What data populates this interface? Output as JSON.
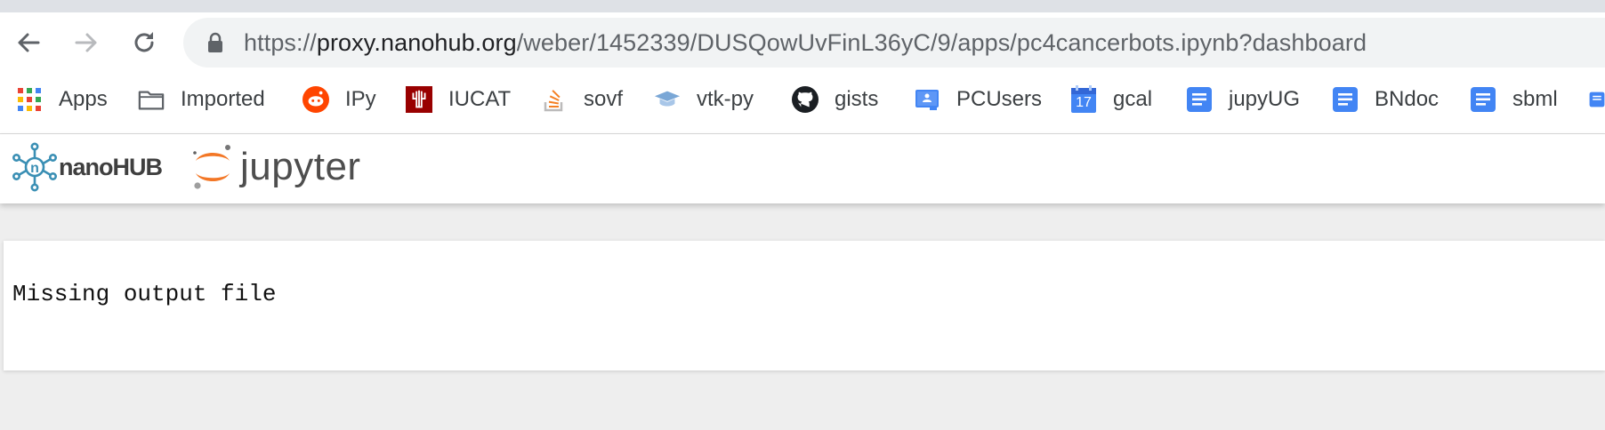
{
  "browser": {
    "url_scheme": "https://",
    "url_host": "proxy.nanohub.org",
    "url_path": "/weber/1452339/DUSQowUvFinL36yC/9/apps/pc4cancerbots.ipynb?dashboard"
  },
  "bookmarks": [
    {
      "label": "Apps",
      "icon": "apps-grid-icon"
    },
    {
      "label": "Imported",
      "icon": "folder-icon"
    },
    {
      "label": "IPy",
      "icon": "reddit-icon"
    },
    {
      "label": "IUCAT",
      "icon": "iu-trident-icon"
    },
    {
      "label": "sovf",
      "icon": "stackoverflow-icon"
    },
    {
      "label": "vtk-py",
      "icon": "graduation-cap-icon"
    },
    {
      "label": "gists",
      "icon": "github-icon"
    },
    {
      "label": "PCUsers",
      "icon": "google-classroom-icon"
    },
    {
      "label": "gcal",
      "icon": "calendar-icon",
      "badge": "17"
    },
    {
      "label": "jupyUG",
      "icon": "google-doc-icon"
    },
    {
      "label": "BNdoc",
      "icon": "google-doc-icon"
    },
    {
      "label": "sbml",
      "icon": "google-doc-icon"
    }
  ],
  "header": {
    "nanohub_logo_text": "nanoHUB",
    "jupyter_logo_text": "jupyter"
  },
  "output": {
    "message": "Missing output file"
  },
  "colors": {
    "nanohub_teal": "#3a8fb4",
    "jupyter_orange": "#f37726",
    "doc_blue": "#4285f4"
  }
}
